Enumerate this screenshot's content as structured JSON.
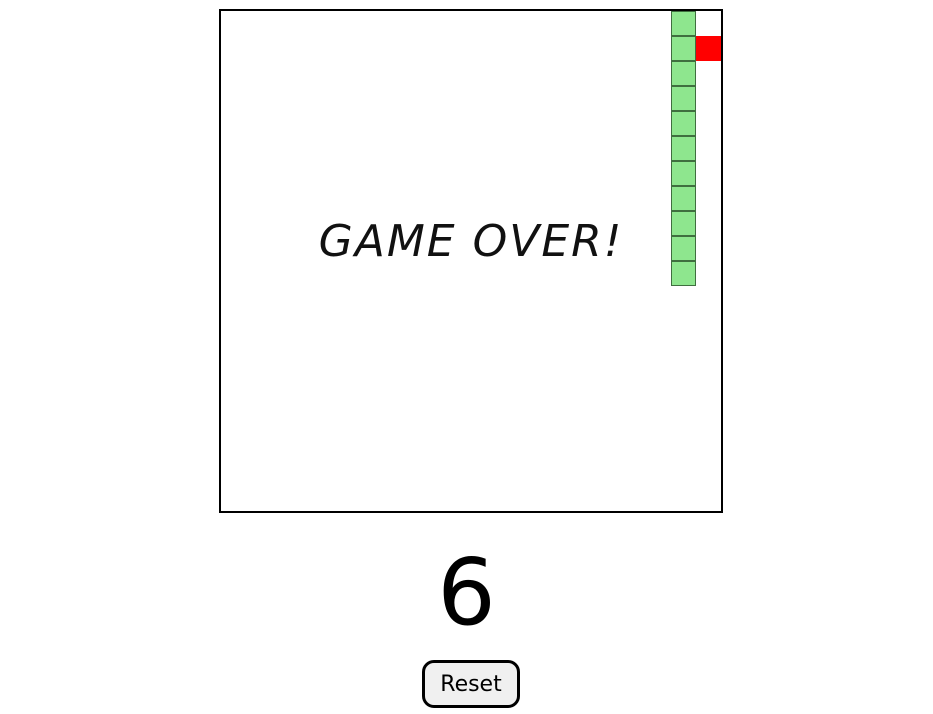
{
  "game": {
    "status_text": "GAME OVER!",
    "score": "6",
    "reset_label": "Reset",
    "grid_size": 20,
    "snake": [
      [
        18,
        0
      ],
      [
        18,
        1
      ],
      [
        18,
        2
      ],
      [
        18,
        3
      ],
      [
        18,
        4
      ],
      [
        18,
        5
      ],
      [
        18,
        6
      ],
      [
        18,
        7
      ],
      [
        18,
        8
      ],
      [
        18,
        9
      ],
      [
        18,
        10
      ]
    ],
    "food": [
      19,
      1
    ],
    "colors": {
      "snake": "#8ee68e",
      "snake_border": "#3f6f3f",
      "food": "#ff0000",
      "board_border": "#000000"
    }
  }
}
